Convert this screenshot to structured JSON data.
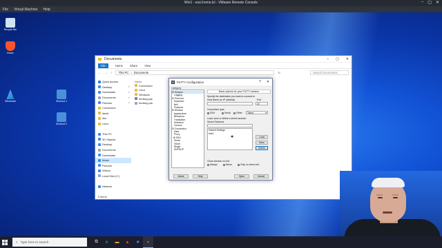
{
  "vm": {
    "title": "Win1 - esxi.home.lcl - VMware Remote Console",
    "menu": [
      "File",
      "Virtual Machine",
      "Help"
    ],
    "controls": [
      "–",
      "▢",
      "✕"
    ]
  },
  "desktop_icons": [
    {
      "label": "Recycle Bin",
      "color": "#cfe3f5"
    },
    {
      "label": "Brave",
      "color": "#fb542b"
    },
    {
      "label": "Wireshark",
      "color": "#1679c4"
    },
    {
      "label": "Shortcut 1",
      "color": "#4a90d9"
    },
    {
      "label": "Shortcut 2",
      "color": "#4a90d9"
    }
  ],
  "explorer": {
    "title": "Documents",
    "ribbon_tabs": [
      "File",
      "Home",
      "Share",
      "View"
    ],
    "address": [
      "This PC",
      "Documents"
    ],
    "search_placeholder": "Search Documents",
    "nav": [
      {
        "label": "Quick access",
        "color": "#2b7de9",
        "pin": false
      },
      {
        "label": "Desktop",
        "color": "#3b8ee8",
        "pin": true
      },
      {
        "label": "Downloads",
        "color": "#3b8ee8",
        "pin": true
      },
      {
        "label": "Documents",
        "color": "#9aa4b1",
        "pin": true
      },
      {
        "label": "Pictures",
        "color": "#3b8ee8",
        "pin": true
      },
      {
        "label": "Conversion",
        "color": "#e8b93b",
        "pin": false
      },
      {
        "label": "david",
        "color": "#e8b93b",
        "pin": false
      },
      {
        "label": "lisd",
        "color": "#e8b93b",
        "pin": false
      },
      {
        "label": "Linux",
        "color": "#e8b93b",
        "pin": false
      },
      {
        "label": "",
        "color": "transparent",
        "pin": false
      },
      {
        "label": "This PC",
        "color": "#3b8ee8",
        "pin": false
      },
      {
        "label": "3D Objects",
        "color": "#3b8ee8",
        "pin": false
      },
      {
        "label": "Desktop",
        "color": "#3b8ee8",
        "pin": false
      },
      {
        "label": "Documents",
        "color": "#9aa4b1",
        "pin": false
      },
      {
        "label": "Downloads",
        "color": "#3b8ee8",
        "pin": false
      },
      {
        "label": "Music",
        "color": "#3b8ee8",
        "pin": false,
        "selected": true
      },
      {
        "label": "Pictures",
        "color": "#3b8ee8",
        "pin": false
      },
      {
        "label": "Videos",
        "color": "#3b8ee8",
        "pin": false
      },
      {
        "label": "Local Disk (C:)",
        "color": "#9aa4b1",
        "pin": false
      },
      {
        "label": "",
        "color": "transparent",
        "pin": false
      },
      {
        "label": "Network",
        "color": "#3b8ee8",
        "pin": false
      }
    ],
    "column_header": "Name",
    "files": [
      {
        "name": "Conversion",
        "color": "#e8b93b"
      },
      {
        "name": "Linux",
        "color": "#e8b93b"
      },
      {
        "name": "Windows",
        "color": "#e8b93b"
      },
      {
        "name": "fredkey.ppk",
        "color": "#6e7c96"
      },
      {
        "name": "fredkey.pub",
        "color": "#9aa4b1"
      }
    ],
    "status": "5 items"
  },
  "putty": {
    "title": "PuTTY Configuration",
    "help_glyph": "?",
    "category_label": "Category:",
    "tree": [
      "⊟ Session",
      "   Logging",
      "⊟ Terminal",
      "   Keyboard",
      "   Bell",
      "   Features",
      "⊟ Window",
      "   Appearance",
      "   Behaviour",
      "   Translation",
      "   Selection",
      "   Colours",
      "⊟ Connection",
      "   Data",
      "   Proxy",
      "  ⊞ SSH",
      "   Serial",
      "   Telnet",
      "   Rlogin",
      "   SUPDUP"
    ],
    "header": "Basic options for your PuTTY session",
    "dest_label": "Specify the destination you want to connect to",
    "host_label": "Host Name (or IP address)",
    "port_label": "Port",
    "host_value": "",
    "port_value": "22",
    "conn_type_label": "Connection type:",
    "conn_types": [
      "SSH",
      "Serial",
      "Other:"
    ],
    "other_select": "Telnet",
    "load_label": "Load, save or delete a stored session",
    "saved_label": "Saved Sessions",
    "saved_input": "",
    "sessions": [
      "Default Settings",
      "test1"
    ],
    "btn_load": "Load",
    "btn_save": "Save",
    "btn_delete": "Delete",
    "close_label": "Close window on exit:",
    "close_opts": [
      "Always",
      "Never",
      "Only on clean exit"
    ],
    "btn_about": "About",
    "btn_help": "Help",
    "btn_open": "Open",
    "btn_cancel": "Cancel"
  },
  "taskbar": {
    "search_placeholder": "Type here to search",
    "apps": [
      {
        "name": "task-view",
        "glyph": "⧉",
        "color": "#dddddd"
      },
      {
        "name": "edge",
        "glyph": "e",
        "color": "#2ea8e0"
      },
      {
        "name": "file-explorer",
        "glyph": "▬",
        "color": "#e8b93b"
      },
      {
        "name": "brave",
        "glyph": "▲",
        "color": "#fb542b"
      },
      {
        "name": "store",
        "glyph": "■",
        "color": "#3b8ee8"
      },
      {
        "name": "putty",
        "glyph": "⌁",
        "color": "#cfd6e4"
      }
    ]
  }
}
